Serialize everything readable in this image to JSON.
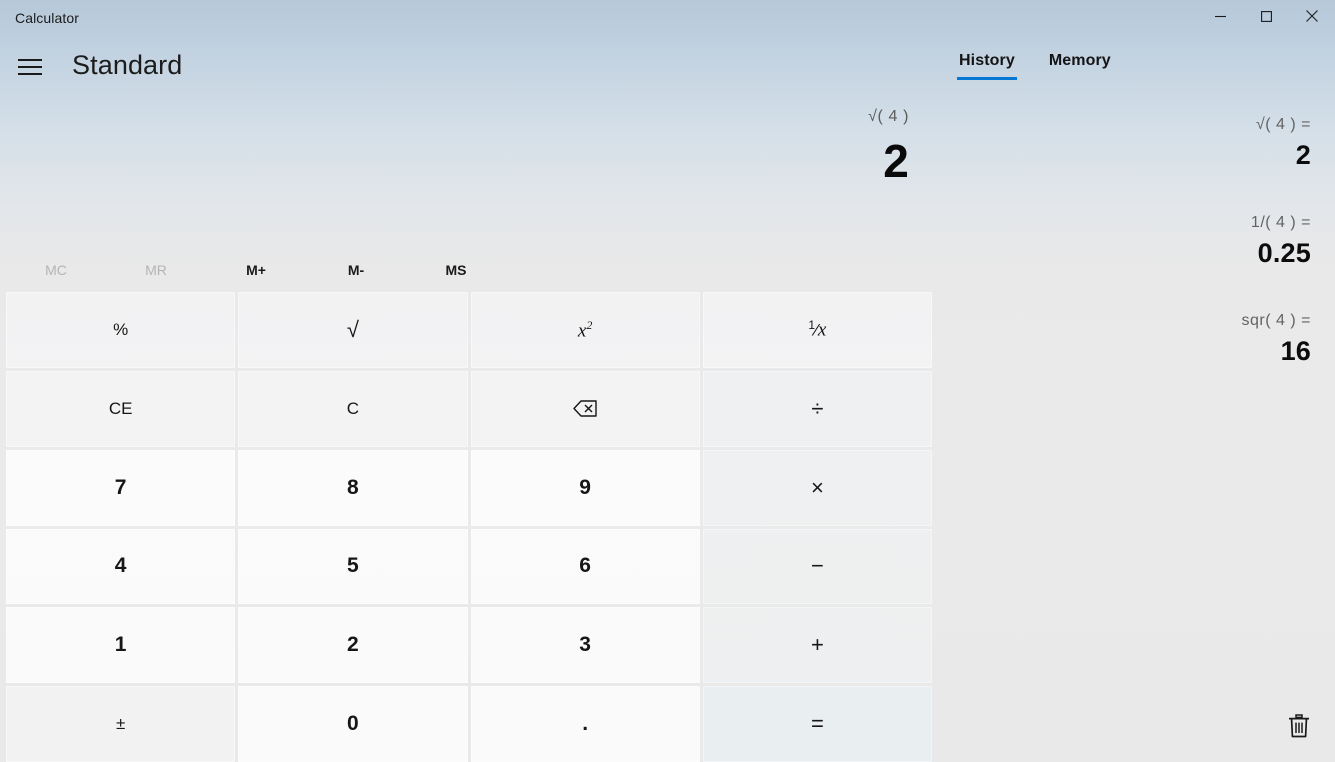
{
  "window": {
    "title": "Calculator",
    "controls": [
      {
        "name": "minimize-button",
        "icon": "minimize-icon"
      },
      {
        "name": "maximize-button",
        "icon": "maximize-icon"
      },
      {
        "name": "close-button",
        "icon": "close-icon"
      }
    ]
  },
  "header": {
    "menu_icon": "hamburger-menu-icon",
    "mode": "Standard"
  },
  "tabs": [
    {
      "label": "History",
      "active": true
    },
    {
      "label": "Memory",
      "active": false
    }
  ],
  "display": {
    "expression": "√( 4 )",
    "result": "2"
  },
  "memory": {
    "buttons": [
      {
        "label": "MC",
        "enabled": false
      },
      {
        "label": "MR",
        "enabled": false
      },
      {
        "label": "M+",
        "enabled": true
      },
      {
        "label": "M-",
        "enabled": true
      },
      {
        "label": "MS",
        "enabled": true
      }
    ]
  },
  "keypad": {
    "rows": [
      [
        {
          "label": "%",
          "type": "fn",
          "name": "percent-button"
        },
        {
          "label": "√",
          "type": "fn",
          "name": "square-root-button"
        },
        {
          "label": "x²",
          "type": "fn",
          "name": "square-button"
        },
        {
          "label": "¹/x",
          "type": "fn",
          "name": "reciprocal-button"
        }
      ],
      [
        {
          "label": "CE",
          "type": "fn",
          "name": "clear-entry-button"
        },
        {
          "label": "C",
          "type": "fn",
          "name": "clear-button"
        },
        {
          "label": "backspace",
          "type": "fn",
          "name": "backspace-button"
        },
        {
          "label": "÷",
          "type": "op",
          "name": "divide-button"
        }
      ],
      [
        {
          "label": "7",
          "type": "num",
          "name": "digit-7-button"
        },
        {
          "label": "8",
          "type": "num",
          "name": "digit-8-button"
        },
        {
          "label": "9",
          "type": "num",
          "name": "digit-9-button"
        },
        {
          "label": "×",
          "type": "op",
          "name": "multiply-button"
        }
      ],
      [
        {
          "label": "4",
          "type": "num",
          "name": "digit-4-button"
        },
        {
          "label": "5",
          "type": "num",
          "name": "digit-5-button"
        },
        {
          "label": "6",
          "type": "num",
          "name": "digit-6-button"
        },
        {
          "label": "−",
          "type": "op",
          "name": "subtract-button"
        }
      ],
      [
        {
          "label": "1",
          "type": "num",
          "name": "digit-1-button"
        },
        {
          "label": "2",
          "type": "num",
          "name": "digit-2-button"
        },
        {
          "label": "3",
          "type": "num",
          "name": "digit-3-button"
        },
        {
          "label": "+",
          "type": "op",
          "name": "add-button"
        }
      ],
      [
        {
          "label": "±",
          "type": "fn",
          "name": "negate-button"
        },
        {
          "label": "0",
          "type": "num",
          "name": "digit-0-button"
        },
        {
          "label": ".",
          "type": "num",
          "name": "decimal-point-button"
        },
        {
          "label": "=",
          "type": "eq",
          "name": "equals-button"
        }
      ]
    ]
  },
  "history": {
    "items": [
      {
        "expression": "√( 4 ) =",
        "value": "2"
      },
      {
        "expression": "1/( 4 ) =",
        "value": "0.25"
      },
      {
        "expression": "sqr( 4 ) =",
        "value": "16"
      }
    ],
    "clear_icon": "trash-icon"
  },
  "colors": {
    "accent": "#0078d4",
    "title_bar_top": "#b6c9d8",
    "panel_bg": "#e9e9e9",
    "text_primary": "#1a1a1a",
    "text_secondary": "#5c5c5c",
    "text_disabled": "#b4b4b4"
  }
}
